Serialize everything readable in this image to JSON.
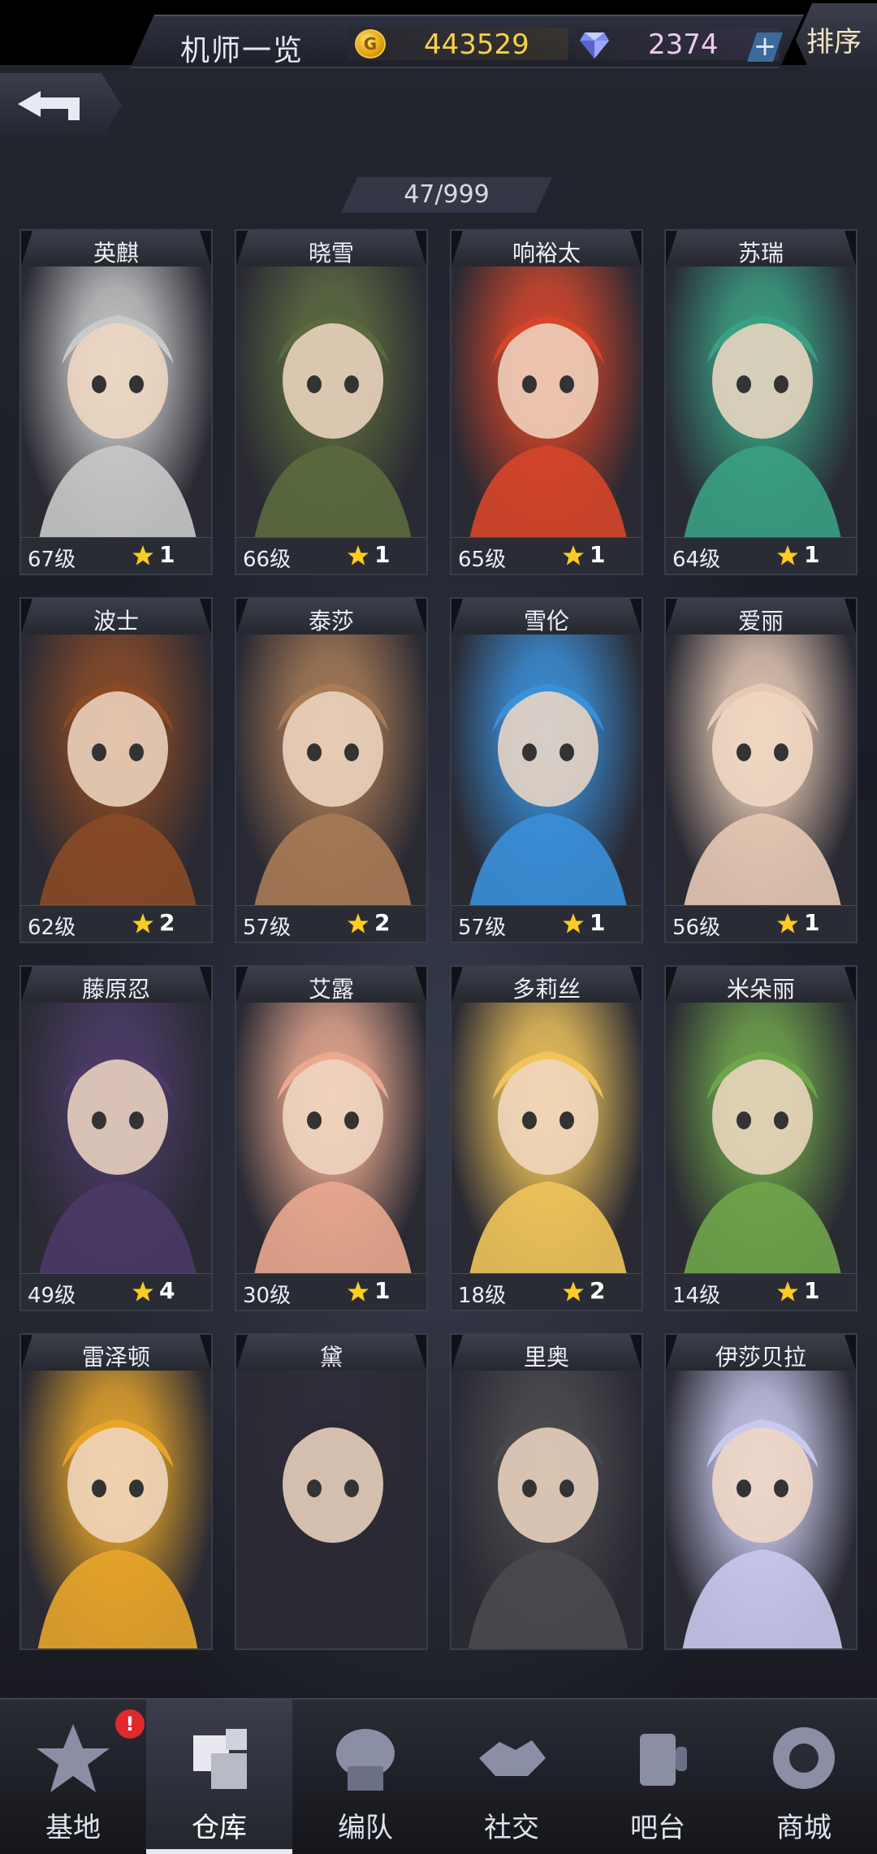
{
  "header": {
    "title": "机师一览",
    "gold": "443529",
    "gems": "2374",
    "plus": "+",
    "sort_label": "排序",
    "gold_symbol": "G"
  },
  "roster": {
    "count": "47/999",
    "pilots": [
      {
        "name": "英麒",
        "level": "67级",
        "stars": "1",
        "color": "#c8c9c8"
      },
      {
        "name": "晓雪",
        "level": "66级",
        "stars": "1",
        "color": "#5b6a3e"
      },
      {
        "name": "响裕太",
        "level": "65级",
        "stars": "1",
        "color": "#d6452a"
      },
      {
        "name": "苏瑞",
        "level": "64级",
        "stars": "1",
        "color": "#3aa083"
      },
      {
        "name": "波士",
        "level": "62级",
        "stars": "2",
        "color": "#8a4a26"
      },
      {
        "name": "泰莎",
        "level": "57级",
        "stars": "2",
        "color": "#a87a55"
      },
      {
        "name": "雪伦",
        "level": "57级",
        "stars": "1",
        "color": "#3a8fd9"
      },
      {
        "name": "爱丽",
        "level": "56级",
        "stars": "1",
        "color": "#e6c9b4"
      },
      {
        "name": "藤原忍",
        "level": "49级",
        "stars": "4",
        "color": "#4b3a66"
      },
      {
        "name": "艾露",
        "level": "30级",
        "stars": "1",
        "color": "#e9a98f"
      },
      {
        "name": "多莉丝",
        "level": "18级",
        "stars": "2",
        "color": "#f0c45a"
      },
      {
        "name": "米朵丽",
        "level": "14级",
        "stars": "1",
        "color": "#6fa54a"
      },
      {
        "name": "雷泽顿",
        "level": "",
        "stars": "",
        "color": "#e8a52a"
      },
      {
        "name": "黛",
        "level": "",
        "stars": "",
        "color": "#2d2a36"
      },
      {
        "name": "里奥",
        "level": "",
        "stars": "",
        "color": "#4a4a4e"
      },
      {
        "name": "伊莎贝拉",
        "level": "",
        "stars": "",
        "color": "#c9c9ee"
      }
    ]
  },
  "nav": {
    "items": [
      {
        "label": "基地",
        "icon": "base-icon"
      },
      {
        "label": "仓库",
        "icon": "warehouse-icon"
      },
      {
        "label": "编队",
        "icon": "formation-icon"
      },
      {
        "label": "社交",
        "icon": "social-icon"
      },
      {
        "label": "吧台",
        "icon": "bar-icon"
      },
      {
        "label": "商城",
        "icon": "shop-icon"
      }
    ],
    "active_index": 1,
    "badge": "!"
  },
  "colors": {
    "gold": "#f6d14a",
    "gem": "#f0c8f2",
    "star": "#ffcc22",
    "badge": "#e0282d"
  }
}
